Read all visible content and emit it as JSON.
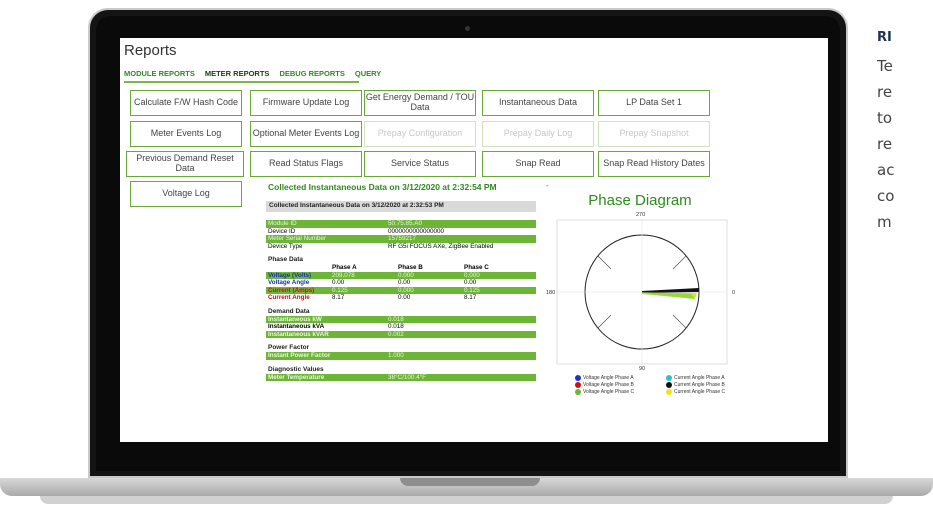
{
  "screen": {
    "title": "Reports",
    "tabs": [
      "MODULE REPORTS",
      "METER REPORTS",
      "DEBUG REPORTS",
      "QUERY"
    ],
    "buttons": [
      {
        "label": "Calculate F/W Hash Code",
        "enabled": true
      },
      {
        "label": "Firmware Update Log",
        "enabled": true
      },
      {
        "label": "Get Energy Demand / TOU Data",
        "enabled": true
      },
      {
        "label": "Instantaneous Data",
        "enabled": true
      },
      {
        "label": "LP Data Set 1",
        "enabled": true
      },
      {
        "label": "Meter Events Log",
        "enabled": true
      },
      {
        "label": "Optional Meter Events Log",
        "enabled": true
      },
      {
        "label": "Prepay Configuration",
        "enabled": false
      },
      {
        "label": "Prepay Daily Log",
        "enabled": false
      },
      {
        "label": "Prepay Snapshot",
        "enabled": false
      },
      {
        "label": "Previous Demand Reset Data",
        "enabled": true
      },
      {
        "label": "Read Status Flags",
        "enabled": true
      },
      {
        "label": "Service Status",
        "enabled": true
      },
      {
        "label": "Snap Read",
        "enabled": true
      },
      {
        "label": "Snap Read History Dates",
        "enabled": true
      },
      {
        "label": "Voltage Log",
        "enabled": true
      }
    ],
    "collected_title": "Collected Instantaneous Data on 3/12/2020 at 2:32:54 PM",
    "dash": "-",
    "table_header": "Collected Instantaneous Data on 3/12/2020 at 2:32:53 PM",
    "device": [
      {
        "k": "Module ID",
        "v": "50.75.85.A0"
      },
      {
        "k": "Device ID",
        "v": "0000000000000000"
      },
      {
        "k": "Meter Serial Number",
        "v": "15759217"
      },
      {
        "k": "Device Type",
        "v": "RF G5i FOCUS AXe, ZigBee Enabled"
      }
    ],
    "phase_section": "Phase Data",
    "phase_cols": [
      "",
      "Phase A",
      "Phase B",
      "Phase C"
    ],
    "phase_rows": [
      {
        "label": "Voltage (Volts)",
        "a": "209.078",
        "b": "0.000",
        "c": "0.000",
        "color": "#1f2fb3"
      },
      {
        "label": "Voltage Angle",
        "a": "0.00",
        "b": "0.00",
        "c": "0.00",
        "color": "#1f2fb3"
      },
      {
        "label": "Current (Amps)",
        "a": "0.125",
        "b": "0.000",
        "c": "0.125",
        "color": "#d01010"
      },
      {
        "label": "Current Angle",
        "a": "8.17",
        "b": "0.00",
        "c": "8.17",
        "color": "#d01010"
      }
    ],
    "demand_section": "Demand Data",
    "demand": [
      {
        "k": "Instantaneous kW",
        "v": "0.018"
      },
      {
        "k": "Instantaneous kVA",
        "v": "0.018"
      },
      {
        "k": "Instantaneous kVAR",
        "v": "0.002"
      }
    ],
    "pf_section": "Power Factor",
    "pf": [
      {
        "k": "Instant Power Factor",
        "v": "1.000"
      }
    ],
    "diag_section": "Diagnostic Values",
    "diag": [
      {
        "k": "Meter Temperature",
        "v": "38°C/100.4°F"
      }
    ],
    "phase_diagram": {
      "title": "Phase Diagram",
      "labels": {
        "top": "270",
        "left": "180",
        "right": "0",
        "bottom": "90"
      },
      "legend": [
        [
          "Voltage Angle Phase A",
          "#1f2fd0",
          "Current Angle Phase A",
          "#22c7c7"
        ],
        [
          "Voltage Angle Phase B",
          "#d01010",
          "Current Angle Phase B",
          "#111111"
        ],
        [
          "Voltage Angle Phase C",
          "#6cb536",
          "Current Angle Phase C",
          "#f2e21a"
        ]
      ]
    }
  },
  "side_text": {
    "heading": "RI",
    "lines": [
      "Te",
      "re",
      "to",
      "re",
      "ac",
      "co",
      "m"
    ]
  }
}
